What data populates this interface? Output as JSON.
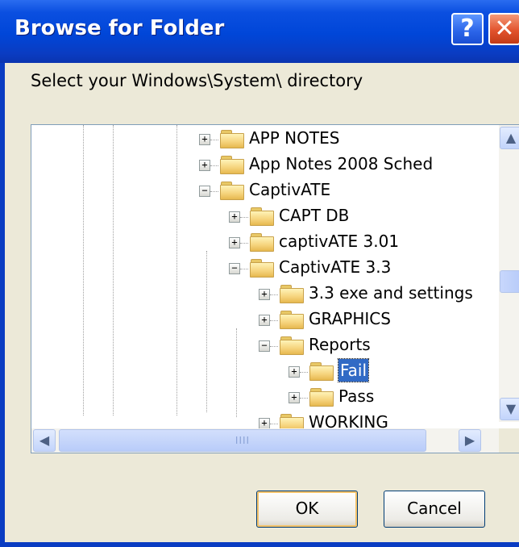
{
  "window": {
    "title": "Browse for Folder",
    "help_label": "?",
    "close_label": "✕"
  },
  "prompt": "Select your Windows\\System\\ directory",
  "tree": {
    "items": [
      {
        "label": "APP NOTES",
        "expander": "+",
        "selected": false
      },
      {
        "label": "App Notes 2008 Sched",
        "expander": "+",
        "selected": false
      },
      {
        "label": "CaptivATE",
        "expander": "−",
        "selected": false
      },
      {
        "label": "CAPT DB",
        "expander": "+",
        "selected": false
      },
      {
        "label": "captivATE 3.01",
        "expander": "+",
        "selected": false
      },
      {
        "label": "CaptivATE 3.3",
        "expander": "−",
        "selected": false
      },
      {
        "label": "3.3 exe and settings",
        "expander": "+",
        "selected": false
      },
      {
        "label": "GRAPHICS",
        "expander": "+",
        "selected": false
      },
      {
        "label": "Reports",
        "expander": "−",
        "selected": false
      },
      {
        "label": "Fail",
        "expander": "+",
        "selected": true
      },
      {
        "label": "Pass",
        "expander": "+",
        "selected": false
      },
      {
        "label": "WORKING",
        "expander": "+",
        "selected": false
      }
    ]
  },
  "scrollbar": {
    "up_icon": "▲",
    "down_icon": "▼",
    "left_icon": "◀",
    "right_icon": "▶",
    "grip": "IIII"
  },
  "buttons": {
    "ok": "OK",
    "cancel": "Cancel"
  },
  "colors": {
    "titlebar": "#0046d8",
    "selection": "#316ac5",
    "face": "#ece9d8"
  }
}
